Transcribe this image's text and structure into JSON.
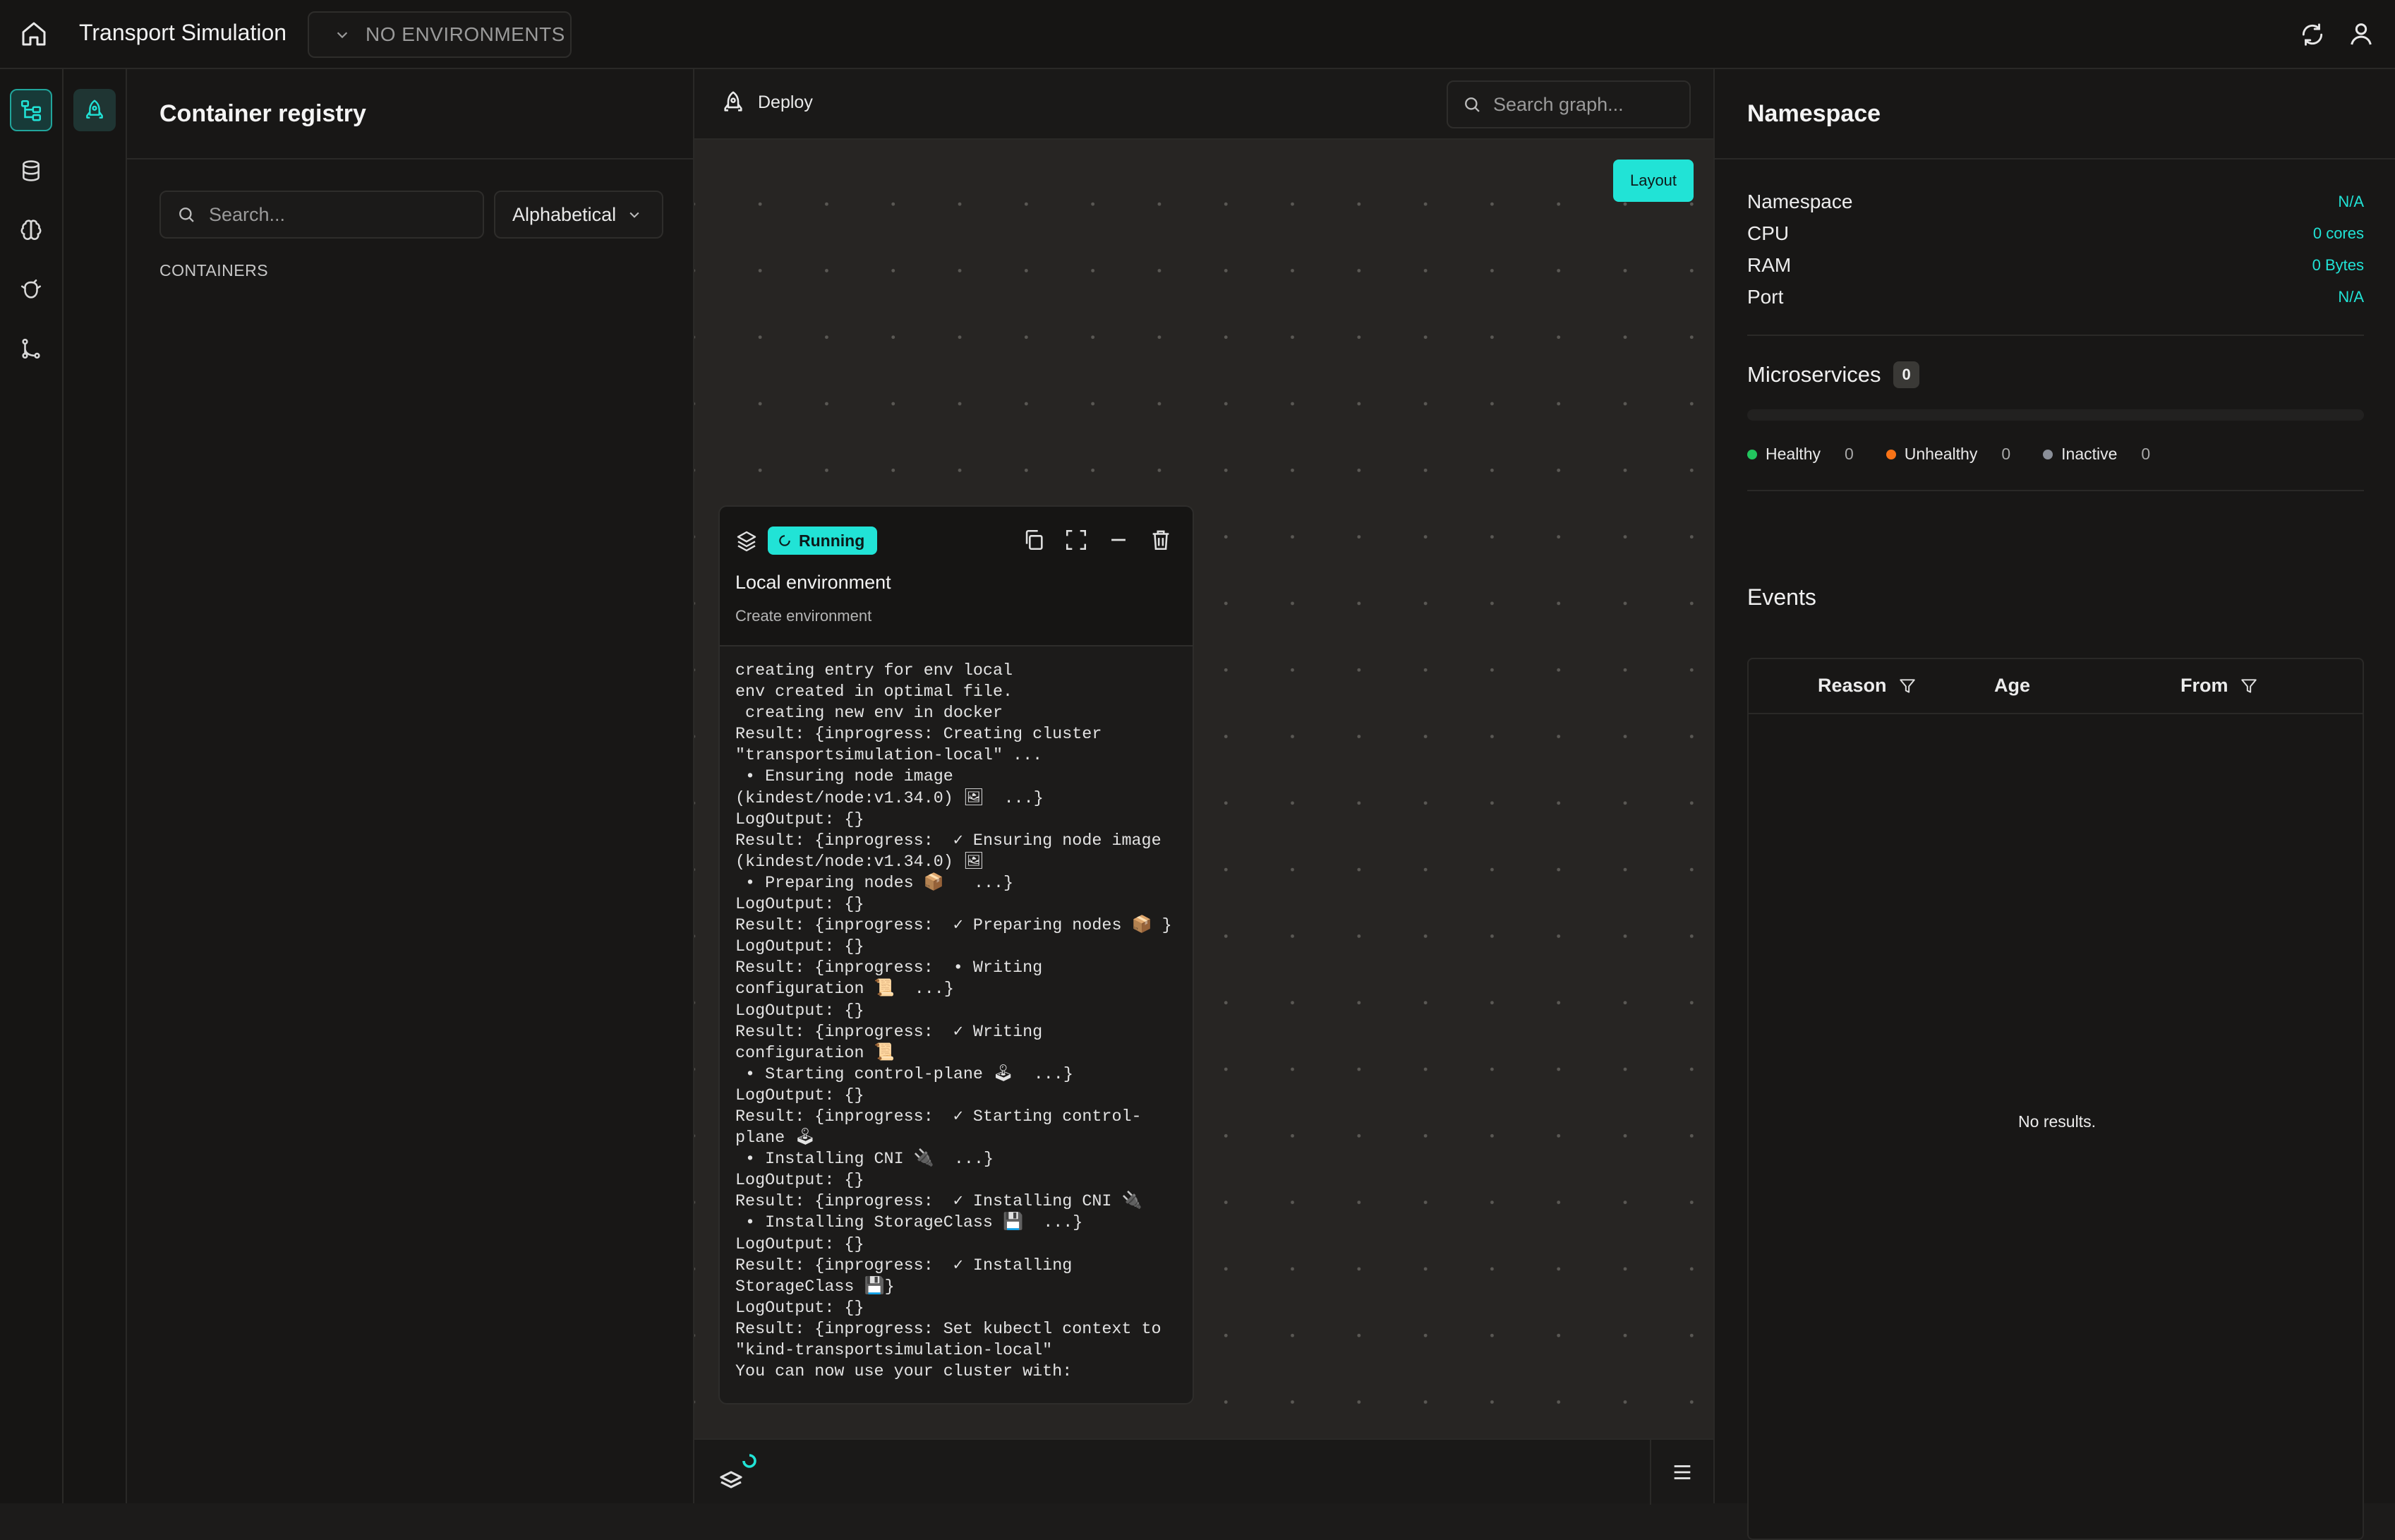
{
  "app": {
    "title": "Transport Simulation"
  },
  "env_selector": {
    "label": "NO ENVIRONMENTS"
  },
  "registry": {
    "title": "Container registry",
    "search_placeholder": "Search...",
    "sort_label": "Alphabetical",
    "section_label": "CONTAINERS"
  },
  "graph": {
    "deploy_label": "Deploy",
    "search_placeholder": "Search graph...",
    "layout_label": "Layout"
  },
  "env_card": {
    "status": "Running",
    "title": "Local environment",
    "subtitle": "Create environment",
    "log": "creating entry for env local\nenv created in optimal file.\n creating new env in docker\nResult: {inprogress: Creating cluster \"transportsimulation-local\" ...\n • Ensuring node image (kindest/node:v1.34.0) 🖼  ...}\nLogOutput: {}\nResult: {inprogress:  ✓ Ensuring node image (kindest/node:v1.34.0) 🖼\n • Preparing nodes 📦   ...}\nLogOutput: {}\nResult: {inprogress:  ✓ Preparing nodes 📦 }\nLogOutput: {}\nResult: {inprogress:  • Writing configuration 📜  ...}\nLogOutput: {}\nResult: {inprogress:  ✓ Writing configuration 📜\n • Starting control-plane 🕹  ...}\nLogOutput: {}\nResult: {inprogress:  ✓ Starting control-plane 🕹\n • Installing CNI 🔌  ...}\nLogOutput: {}\nResult: {inprogress:  ✓ Installing CNI 🔌\n • Installing StorageClass 💾  ...}\nLogOutput: {}\nResult: {inprogress:  ✓ Installing StorageClass 💾}\nLogOutput: {}\nResult: {inprogress: Set kubectl context to \"kind-transportsimulation-local\"\nYou can now use your cluster with:"
  },
  "namespace": {
    "title": "Namespace",
    "fields": [
      {
        "label": "Namespace",
        "value": "N/A"
      },
      {
        "label": "CPU",
        "value": "0 cores"
      },
      {
        "label": "RAM",
        "value": "0 Bytes"
      },
      {
        "label": "Port",
        "value": "N/A"
      }
    ],
    "microservices": {
      "title": "Microservices",
      "count": "0",
      "legend": [
        {
          "label": "Healthy",
          "count": "0",
          "color": "#22c55e"
        },
        {
          "label": "Unhealthy",
          "count": "0",
          "color": "#f97316"
        },
        {
          "label": "Inactive",
          "count": "0",
          "color": "#8a8f98"
        }
      ]
    },
    "events": {
      "title": "Events",
      "columns": [
        "Reason",
        "Age",
        "From"
      ],
      "empty_text": "No results."
    }
  },
  "colors": {
    "accent": "#21e3d6",
    "background": "#1c1b1a",
    "panel": "#181716"
  }
}
